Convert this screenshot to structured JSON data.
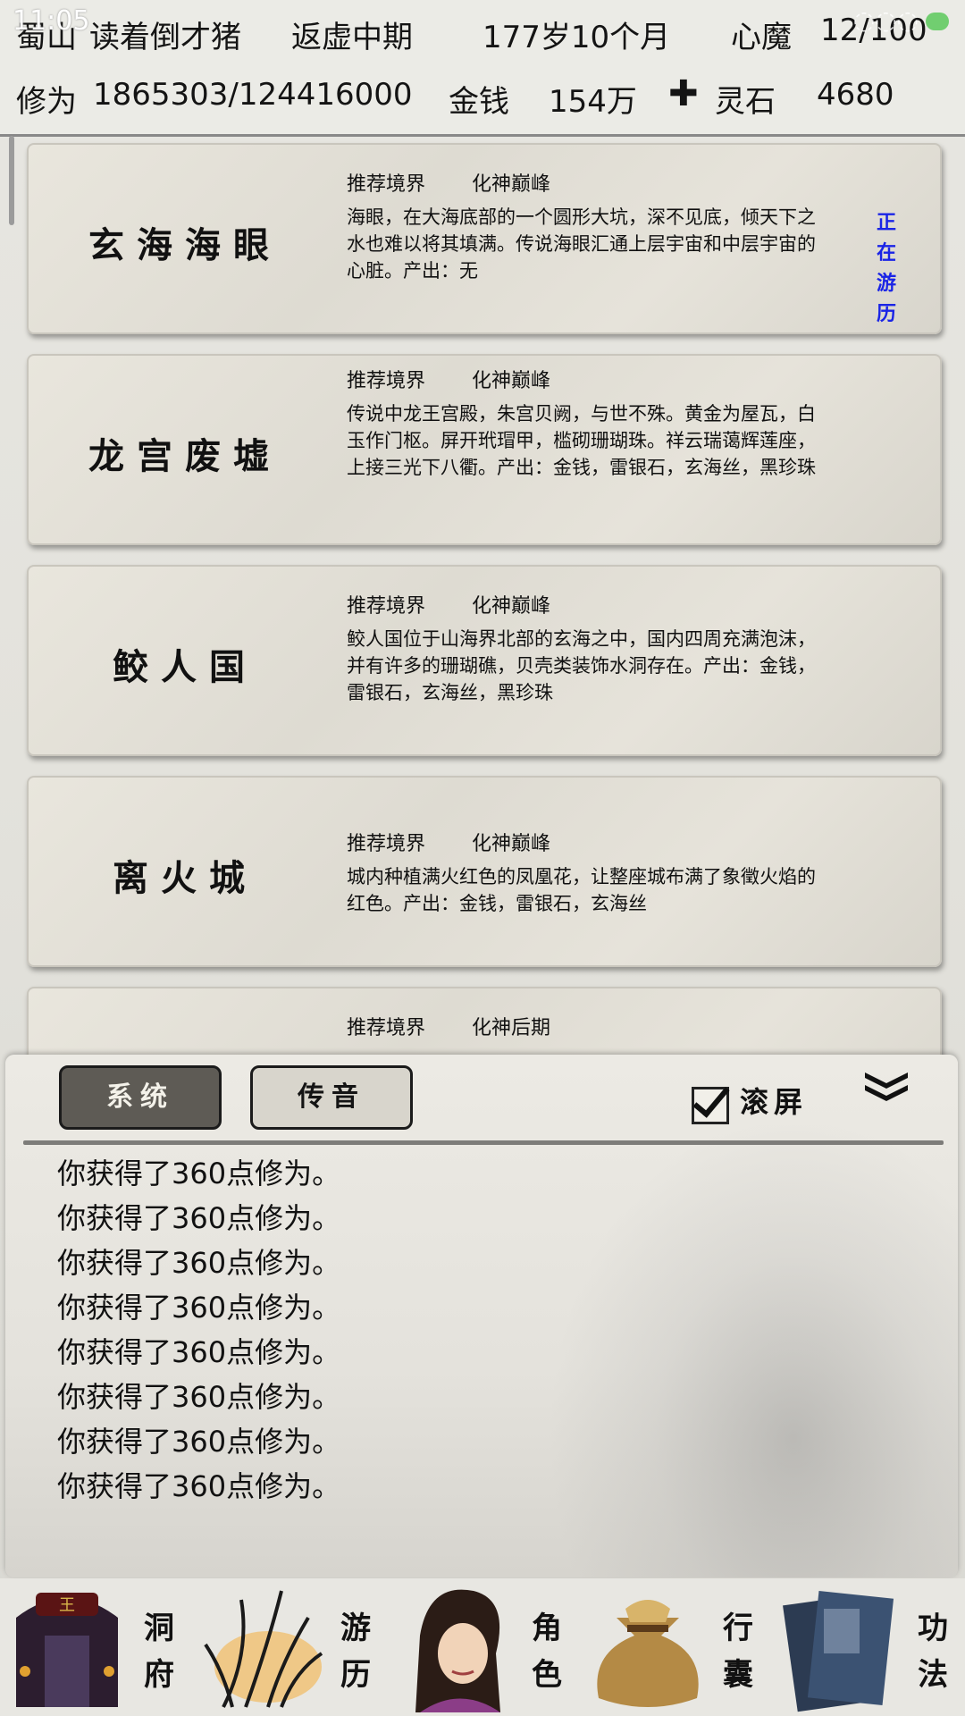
{
  "status_bar": {
    "time": "11:05"
  },
  "header": {
    "location": "蜀山",
    "player_name": "读着倒才猪",
    "realm": "返虚中期",
    "age": "177岁10个月",
    "heart_demon_label": "心魔",
    "heart_demon_value": "12/100",
    "cultivation_label": "修为",
    "cultivation_value": "1865303/124416000",
    "money_label": "金钱",
    "money_value": "154万",
    "spirit_stone_label": "灵石",
    "spirit_stone_value": "4680"
  },
  "locations": [
    {
      "name": "玄海海眼",
      "rec_label": "推荐境界",
      "rec_value": "化神巅峰",
      "description": "海眼，在大海底部的一个圆形大坑，深不见底，倾天下之水也难以将其填满。传说海眼汇通上层宇宙和中层宇宙的心脏。产出：无",
      "status": "正在游历"
    },
    {
      "name": "龙宫废墟",
      "rec_label": "推荐境界",
      "rec_value": "化神巅峰",
      "description": "传说中龙王宫殿，朱宫贝阙，与世不殊。黄金为屋瓦，白玉作门枢。屏开玳瑁甲，槛砌珊瑚珠。祥云瑞蔼辉莲座，上接三光下八衢。产出：金钱，雷银石，玄海丝，黑珍珠",
      "status": ""
    },
    {
      "name": "鲛人国",
      "rec_label": "推荐境界",
      "rec_value": "化神巅峰",
      "description": "鲛人国位于山海界北部的玄海之中，国内四周充满泡沫，并有许多的珊瑚礁，贝壳类装饰水洞存在。产出：金钱，雷银石，玄海丝，黑珍珠",
      "status": ""
    },
    {
      "name": "离火城",
      "rec_label": "推荐境界",
      "rec_value": "化神巅峰",
      "description": "城内种植满火红色的凤凰花，让整座城布满了象徵火焰的红色。产出：金钱，雷银石，玄海丝",
      "status": ""
    },
    {
      "name": "",
      "rec_label": "推荐境界",
      "rec_value": "化神后期",
      "description": "",
      "status": ""
    }
  ],
  "log_panel": {
    "tab_system": "系统",
    "tab_voice": "传音",
    "scroll_checkbox_label": "滚屏",
    "scroll_checked": true,
    "lines": [
      "你获得了360点修为。",
      "你获得了360点修为。",
      "你获得了360点修为。",
      "你获得了360点修为。",
      "你获得了360点修为。",
      "你获得了360点修为。",
      "你获得了360点修为。",
      "你获得了360点修为。"
    ]
  },
  "bottom_nav": [
    {
      "label": "洞府",
      "icon": "palace-icon"
    },
    {
      "label": "游历",
      "icon": "reeds-icon"
    },
    {
      "label": "角色",
      "icon": "character-portrait-icon"
    },
    {
      "label": "行囊",
      "icon": "bag-icon"
    },
    {
      "label": "功法",
      "icon": "scroll-book-icon"
    }
  ],
  "colors": {
    "status_active": "#1a24e6",
    "tab_active_bg": "#5e5b55",
    "tab_inactive_bg": "#d8d5cc"
  }
}
